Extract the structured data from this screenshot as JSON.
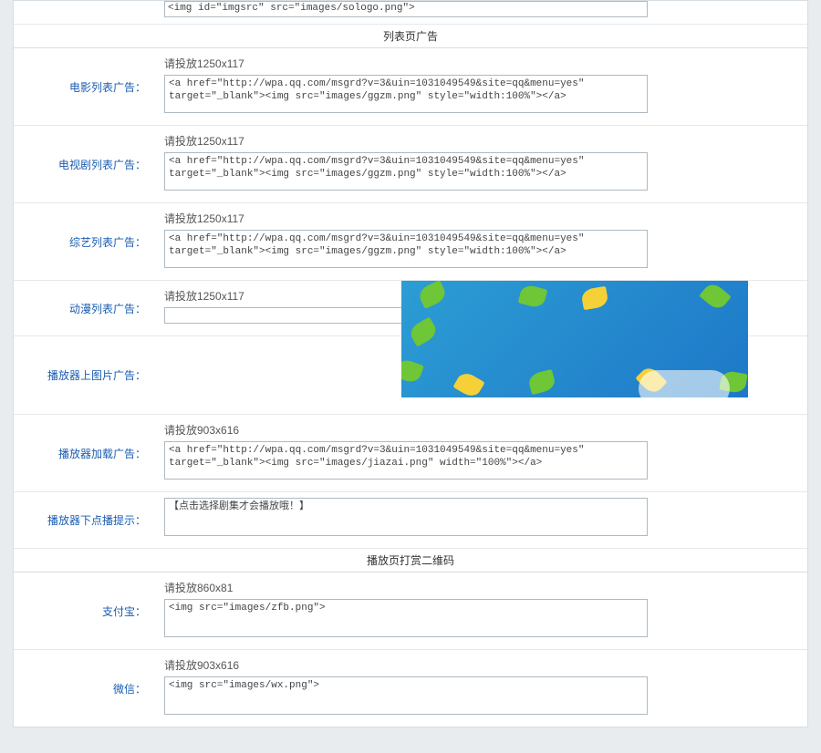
{
  "top_textarea_value": "<img id=\"imgsrc\" src=\"images/sologo.png\">",
  "sections": {
    "list_ads": {
      "header": "列表页广告",
      "rows": [
        {
          "label": "电影列表广告：",
          "hint": "请投放1250x117",
          "value": "<a href=\"http://wpa.qq.com/msgrd?v=3&uin=1031049549&site=qq&menu=yes\" target=\"_blank\"><img src=\"images/ggzm.png\" style=\"width:100%\"></a>"
        },
        {
          "label": "电视剧列表广告：",
          "hint": "请投放1250x117",
          "value": "<a href=\"http://wpa.qq.com/msgrd?v=3&uin=1031049549&site=qq&menu=yes\" target=\"_blank\"><img src=\"images/ggzm.png\" style=\"width:100%\"></a>"
        },
        {
          "label": "综艺列表广告：",
          "hint": "请投放1250x117",
          "value": "<a href=\"http://wpa.qq.com/msgrd?v=3&uin=1031049549&site=qq&menu=yes\" target=\"_blank\"><img src=\"images/ggzm.png\" style=\"width:100%\"></a>"
        },
        {
          "label": "动漫列表广告：",
          "hint": "请投放1250x117",
          "value": ""
        },
        {
          "label": "播放器上图片广告：",
          "hint": "",
          "value": ""
        },
        {
          "label": "播放器加载广告：",
          "hint": "请投放903x616",
          "value": "<a href=\"http://wpa.qq.com/msgrd?v=3&uin=1031049549&site=qq&menu=yes\" target=\"_blank\"><img src=\"images/jiazai.png\" width=\"100%\"></a>"
        },
        {
          "label": "播放器下点播提示：",
          "hint": "",
          "value": "【点击选择剧集才会播放哦！】"
        }
      ]
    },
    "qr_code": {
      "header": "播放页打赏二维码",
      "rows": [
        {
          "label": "支付宝：",
          "hint": "请投放860x81",
          "value": "<img src=\"images/zfb.png\">"
        },
        {
          "label": "微信：",
          "hint": "请投放903x616",
          "value": "<img src=\"images/wx.png\">"
        }
      ]
    }
  }
}
